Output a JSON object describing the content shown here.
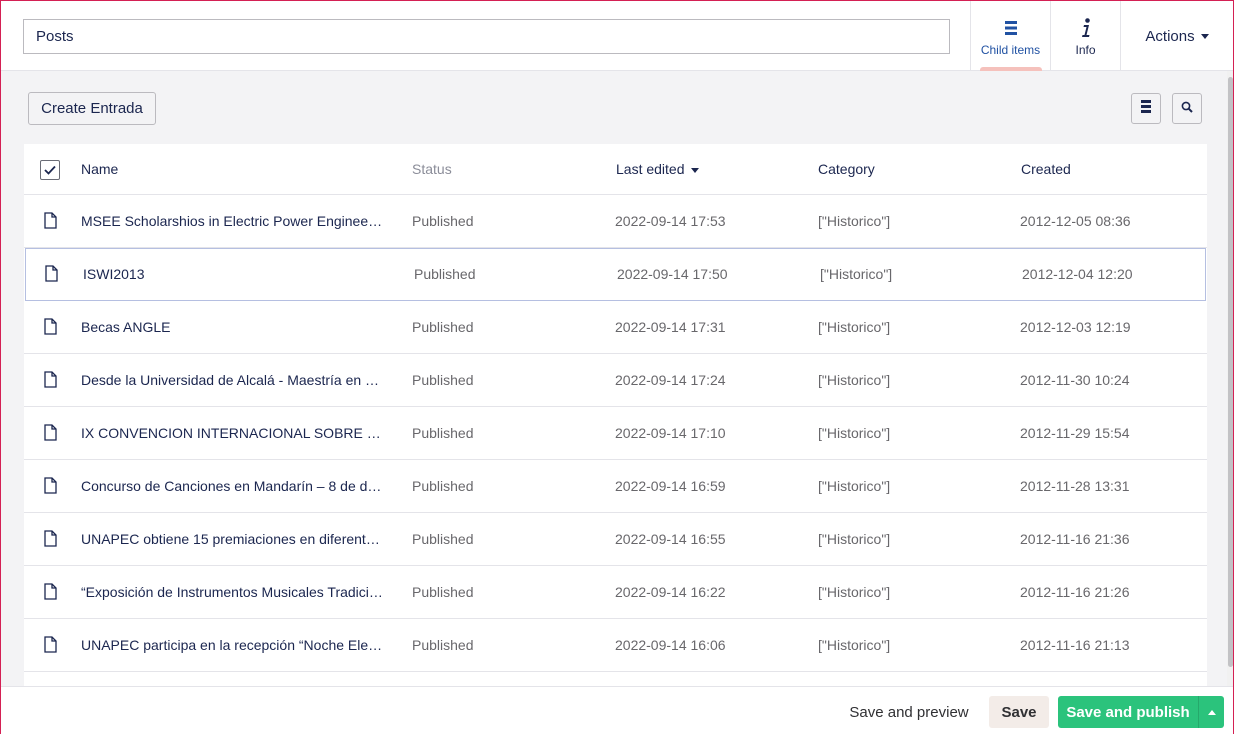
{
  "header": {
    "name_value": "Posts",
    "apps": [
      {
        "label": "Child items",
        "icon": "list-icon",
        "active": true
      },
      {
        "label": "Info",
        "icon": "info-icon",
        "active": false
      }
    ],
    "actions_label": "Actions"
  },
  "toolbar": {
    "create_label": "Create Entrada",
    "list_view_icon": "list-view-icon",
    "search_icon": "search-icon"
  },
  "table": {
    "columns": {
      "name": "Name",
      "status": "Status",
      "last_edited": "Last edited",
      "category": "Category",
      "created": "Created"
    },
    "sort": {
      "column": "Last edited",
      "direction": "descending"
    },
    "rows": [
      {
        "name": "MSEE Scholarshios in Electric Power Engineeri…",
        "status": "Published",
        "last_edited": "2022-09-14 17:53",
        "category": "[\"Historico\"]",
        "created": "2012-12-05 08:36"
      },
      {
        "name": "ISWI2013",
        "status": "Published",
        "last_edited": "2022-09-14 17:50",
        "category": "[\"Historico\"]",
        "created": "2012-12-04 12:20"
      },
      {
        "name": "Becas ANGLE",
        "status": "Published",
        "last_edited": "2022-09-14 17:31",
        "category": "[\"Historico\"]",
        "created": "2012-12-03 12:19"
      },
      {
        "name": "Desde la Universidad de Alcalá - Maestría en …",
        "status": "Published",
        "last_edited": "2022-09-14 17:24",
        "category": "[\"Historico\"]",
        "created": "2012-11-30 10:24"
      },
      {
        "name": "IX CONVENCION INTERNACIONAL SOBRE …",
        "status": "Published",
        "last_edited": "2022-09-14 17:10",
        "category": "[\"Historico\"]",
        "created": "2012-11-29 15:54"
      },
      {
        "name": "Concurso de Canciones en Mandarín – 8 de di…",
        "status": "Published",
        "last_edited": "2022-09-14 16:59",
        "category": "[\"Historico\"]",
        "created": "2012-11-28 13:31"
      },
      {
        "name": "UNAPEC obtiene 15 premiaciones en diferent…",
        "status": "Published",
        "last_edited": "2022-09-14 16:55",
        "category": "[\"Historico\"]",
        "created": "2012-11-16 21:36"
      },
      {
        "name": "“Exposición de Instrumentos Musicales Tradici…",
        "status": "Published",
        "last_edited": "2022-09-14 16:22",
        "category": "[\"Historico\"]",
        "created": "2012-11-16 21:26"
      },
      {
        "name": "UNAPEC participa en la recepción “Noche Ele…",
        "status": "Published",
        "last_edited": "2022-09-14 16:06",
        "category": "[\"Historico\"]",
        "created": "2012-11-16 21:13"
      }
    ]
  },
  "footer": {
    "preview_label": "Save and preview",
    "save_label": "Save",
    "publish_label": "Save and publish"
  },
  "colors": {
    "accent_blue": "#2152a3",
    "publish_green": "#2bc37c",
    "active_underline": "#f5c1bc",
    "text_dark": "#1b264f",
    "text_muted": "#68676b"
  }
}
